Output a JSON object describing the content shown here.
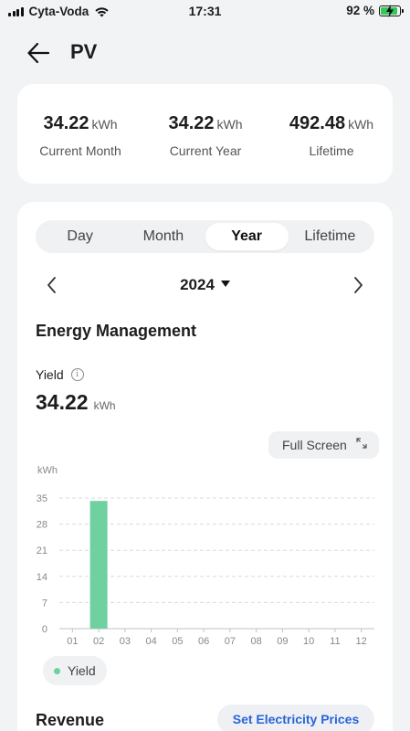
{
  "status_bar": {
    "carrier": "Cyta-Voda",
    "time": "17:31",
    "battery": "92 %",
    "battery_level": 0.92
  },
  "header": {
    "title": "PV"
  },
  "summary": [
    {
      "value": "34.22",
      "unit": "kWh",
      "label": "Current Month"
    },
    {
      "value": "34.22",
      "unit": "kWh",
      "label": "Current Year"
    },
    {
      "value": "492.48",
      "unit": "kWh",
      "label": "Lifetime"
    }
  ],
  "tabs": [
    {
      "label": "Day",
      "active": false
    },
    {
      "label": "Month",
      "active": false
    },
    {
      "label": "Year",
      "active": true
    },
    {
      "label": "Lifetime",
      "active": false
    }
  ],
  "period": {
    "selected": "2024"
  },
  "energy": {
    "title": "Energy Management",
    "yield_label": "Yield",
    "yield_value": "34.22",
    "yield_unit": "kWh",
    "full_screen_label": "Full Screen"
  },
  "chart_data": {
    "type": "bar",
    "ylabel": "kWh",
    "categories": [
      "01",
      "02",
      "03",
      "04",
      "05",
      "06",
      "07",
      "08",
      "09",
      "10",
      "11",
      "12"
    ],
    "series": [
      {
        "name": "Yield",
        "values": [
          0,
          34.22,
          0,
          0,
          0,
          0,
          0,
          0,
          0,
          0,
          0,
          0
        ]
      }
    ],
    "yticks": [
      0,
      7,
      14,
      21,
      28,
      35
    ],
    "ylim": [
      0,
      35
    ],
    "grid": true,
    "legend": "bottom-left",
    "bar_color": "#6fd0a0"
  },
  "revenue": {
    "title": "Revenue",
    "set_prices_label": "Set Electricity Prices"
  },
  "icons": {
    "back": "back-arrow-icon",
    "info": "info-icon",
    "expand": "expand-icon",
    "prev": "chevron-left-icon",
    "next": "chevron-right-icon",
    "dropdown": "caret-down-icon"
  }
}
